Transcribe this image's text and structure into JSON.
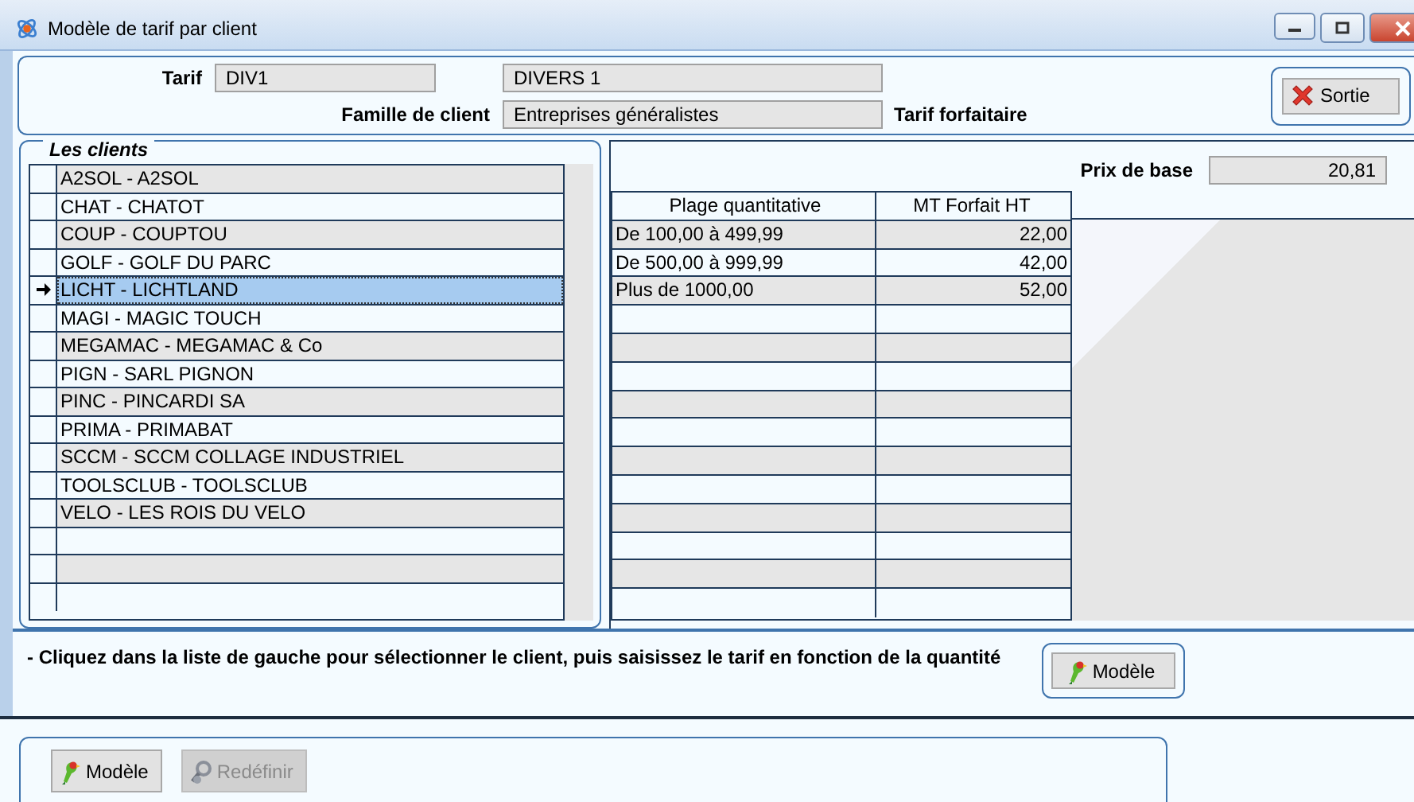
{
  "window": {
    "title": "Modèle de tarif par client"
  },
  "header": {
    "tarif_label": "Tarif",
    "tarif_code": "DIV1",
    "tarif_name": "DIVERS 1",
    "famille_label": "Famille de client",
    "famille_value": "Entreprises généralistes",
    "mode": "Tarif forfaitaire",
    "exit_button": "Sortie"
  },
  "clients": {
    "title": "Les clients",
    "rows": [
      {
        "label": "A2SOL - A2SOL",
        "selected": false
      },
      {
        "label": "CHAT - CHATOT",
        "selected": false
      },
      {
        "label": "COUP - COUPTOU",
        "selected": false
      },
      {
        "label": "GOLF - GOLF DU PARC",
        "selected": false
      },
      {
        "label": "LICHT - LICHTLAND",
        "selected": true
      },
      {
        "label": "MAGI - MAGIC TOUCH",
        "selected": false
      },
      {
        "label": "MEGAMAC - MEGAMAC & Co",
        "selected": false
      },
      {
        "label": "PIGN - SARL PIGNON",
        "selected": false
      },
      {
        "label": "PINC - PINCARDI SA",
        "selected": false
      },
      {
        "label": "PRIMA - PRIMABAT",
        "selected": false
      },
      {
        "label": "SCCM - SCCM COLLAGE INDUSTRIEL",
        "selected": false
      },
      {
        "label": "TOOLSCLUB - TOOLSCLUB",
        "selected": false
      },
      {
        "label": "VELO - LES ROIS DU VELO",
        "selected": false
      }
    ]
  },
  "pricing": {
    "base_price_label": "Prix de base",
    "base_price": "20,81",
    "columns": [
      "Plage quantitative",
      "MT Forfait HT"
    ],
    "rows": [
      {
        "range": "De 100,00 à 499,99",
        "amount": "22,00"
      },
      {
        "range": "De 500,00 à 999,99",
        "amount": "42,00"
      },
      {
        "range": "Plus de 1000,00",
        "amount": "52,00"
      }
    ]
  },
  "hint": {
    "text": "- Cliquez dans la liste de gauche pour sélectionner le client, puis saisissez le tarif en fonction de la quantité",
    "button": "Modèle"
  },
  "footer": {
    "buttons": [
      {
        "label": "Modèle",
        "kind": "model",
        "disabled": false
      },
      {
        "label": "Redéfinir",
        "kind": "redefine",
        "disabled": true
      }
    ]
  }
}
